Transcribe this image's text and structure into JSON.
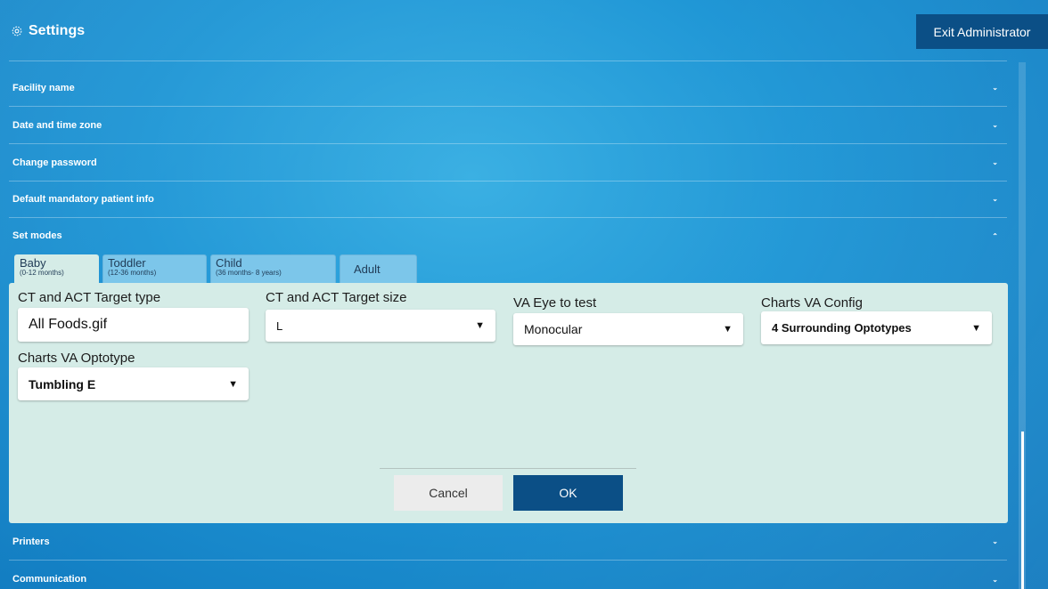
{
  "header": {
    "title": "Settings",
    "exit_label": "Exit Administrator"
  },
  "sections": {
    "facility_name": "Facility name",
    "date_time_zone": "Date and time zone",
    "change_password": "Change password",
    "default_mandatory": "Default mandatory patient info",
    "set_modes": "Set modes",
    "printers": "Printers",
    "communication": "Communication"
  },
  "tabs": [
    {
      "name": "Baby",
      "sub": "(0-12 months)"
    },
    {
      "name": "Toddler",
      "sub": "(12-36 months)"
    },
    {
      "name": "Child",
      "sub": "(36 months- 8 years)"
    },
    {
      "name": "Adult",
      "sub": ""
    }
  ],
  "form": {
    "target_type_label": "CT and ACT Target type",
    "target_type_value": "All Foods.gif",
    "target_size_label": "CT and ACT Target size",
    "target_size_value": "L",
    "eye_label": "VA Eye to test",
    "eye_value": "Monocular",
    "charts_config_label": "Charts VA Config",
    "charts_config_value": "4 Surrounding Optotypes",
    "optotype_label": "Charts VA Optotype",
    "optotype_value": "Tumbling E"
  },
  "actions": {
    "cancel_label": "Cancel",
    "ok_label": "OK"
  },
  "icons": {
    "collapsed": "chevron-down-icon",
    "expanded": "chevron-up-icon",
    "settings": "gear-icon",
    "dropdown": "caret-down-icon"
  },
  "colors": {
    "accent": "#0b4f86",
    "panel": "#d5ece7",
    "tab": "#7cc6ea"
  }
}
